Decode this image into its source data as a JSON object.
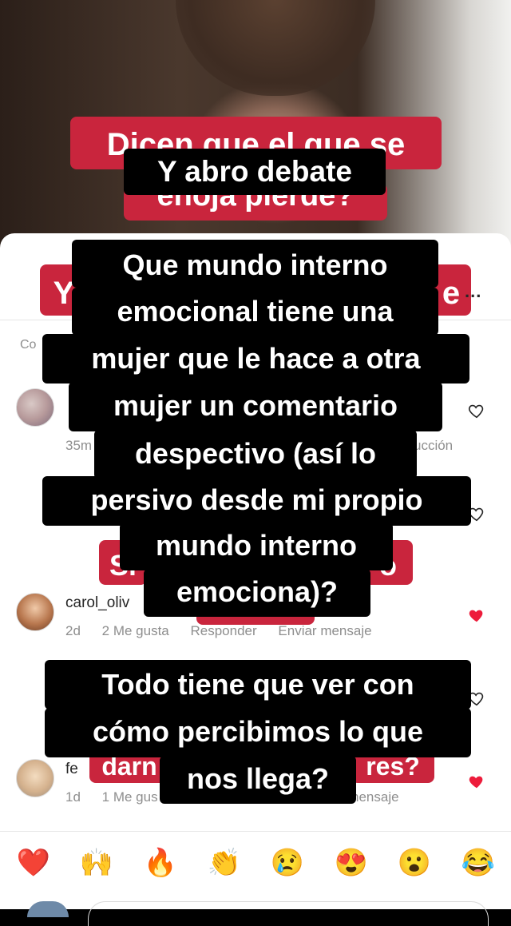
{
  "story": {
    "pink_texts": [
      "Dicen que el que se",
      "enoja pierde?",
      "Y",
      "e",
      "Si",
      "o",
      "",
      "darn",
      "res?"
    ]
  },
  "sheet": {
    "more": "...",
    "comments_label": "Co",
    "comments": [
      {
        "username": "",
        "time": "35m",
        "likes": "",
        "reply": "",
        "send": "ucción",
        "liked": false
      },
      {
        "username": "carol_oliv",
        "time": "2d",
        "likes": "2 Me gusta",
        "reply": "Responder",
        "send": "Enviar mensaje",
        "liked": true
      },
      {
        "username": "fe",
        "time": "1d",
        "likes": "1 Me gus",
        "reply": "",
        "send": "nensaje",
        "liked": true
      }
    ]
  },
  "emojis": [
    {
      "glyph": "❤️",
      "icon": "heart-emoji"
    },
    {
      "glyph": "🙌",
      "icon": "raised-hands-emoji"
    },
    {
      "glyph": "🔥",
      "icon": "fire-emoji"
    },
    {
      "glyph": "👏",
      "icon": "clapping-emoji"
    },
    {
      "glyph": "😢",
      "icon": "crying-emoji"
    },
    {
      "glyph": "😍",
      "icon": "heart-eyes-emoji"
    },
    {
      "glyph": "😮",
      "icon": "surprised-emoji"
    },
    {
      "glyph": "😂",
      "icon": "laughing-emoji"
    }
  ],
  "captions": {
    "c1": "Y abro debate",
    "c2_lines": [
      "Que mundo interno",
      "emocional tiene una",
      "mujer que le hace a otra",
      "mujer un comentario",
      "despectivo (así lo",
      "persivo desde mi propio",
      "mundo interno",
      "emociona)?"
    ],
    "c3_lines": [
      "Todo tiene que ver con",
      "cómo percibimos lo que",
      "nos llega?"
    ]
  },
  "colors": {
    "pink": "#c9253d",
    "like_red": "#ed1c3b"
  }
}
